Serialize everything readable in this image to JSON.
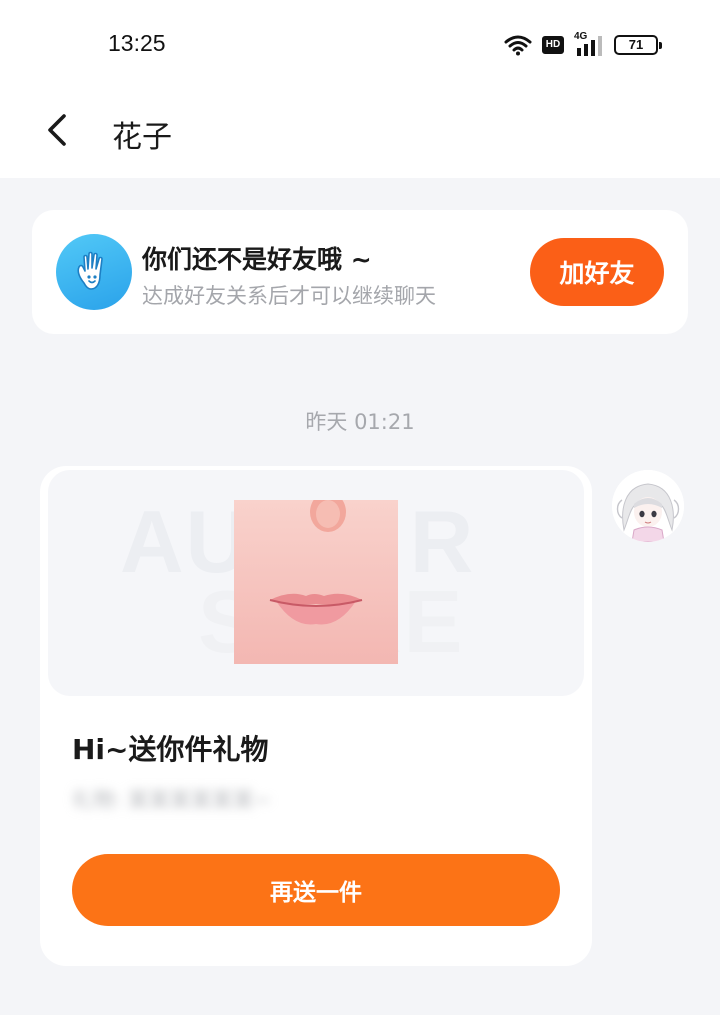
{
  "status_bar": {
    "time": "13:25",
    "network_badge": "HD",
    "network_type": "4G",
    "battery": "71",
    "icons": [
      "wifi-icon",
      "hd-icon",
      "signal-4g-icon",
      "battery-icon"
    ]
  },
  "nav": {
    "back_icon": "chevron-left-icon",
    "title": "花子"
  },
  "friend_banner": {
    "icon": "hand-wave-icon",
    "title": "你们还不是好友哦 ~",
    "subtitle": "达成好友关系后才可以继续聊天",
    "button_label": "加好友"
  },
  "chat": {
    "timestamp": "昨天 01:21",
    "gift_card": {
      "title": "Hi~送你件礼物",
      "subtitle": "礼物: 某某某某某某~",
      "button_label": "再送一件"
    }
  },
  "colors": {
    "accent_orange": "#fb5f17",
    "button_orange": "#fc7316",
    "page_bg": "#f4f5f8",
    "icon_blue": "#2aa2ea"
  }
}
